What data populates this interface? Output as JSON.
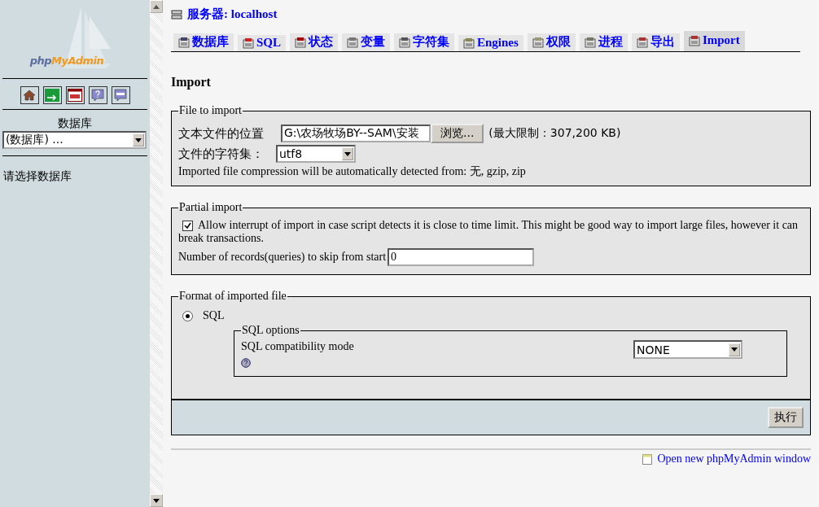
{
  "sidebar": {
    "logo": [
      "php",
      "MyAdmin"
    ],
    "icon_buttons": [
      {
        "kind": "home"
      },
      {
        "kind": "exit"
      },
      {
        "kind": "query"
      },
      {
        "kind": "help"
      },
      {
        "kind": "docs"
      }
    ],
    "db_label": "数据库",
    "db_select": {
      "value": "(数据库) ..."
    },
    "hint": "请选择数据库"
  },
  "server": {
    "label": "服务器",
    "host": ": localhost"
  },
  "tabs": [
    {
      "label": "数据库",
      "kind": "db",
      "selected": false
    },
    {
      "label": "SQL",
      "kind": "sql",
      "selected": false
    },
    {
      "label": "状态",
      "kind": "status",
      "selected": false
    },
    {
      "label": "变量",
      "kind": "vars",
      "selected": false
    },
    {
      "label": "字符集",
      "kind": "charset",
      "selected": false
    },
    {
      "label": "Engines",
      "kind": "engines",
      "selected": false
    },
    {
      "label": "权限",
      "kind": "priv",
      "selected": false
    },
    {
      "label": "进程",
      "kind": "proc",
      "selected": false
    },
    {
      "label": "导出",
      "kind": "export",
      "selected": false
    },
    {
      "label": "Import",
      "kind": "import",
      "selected": true
    }
  ],
  "heading": "Import",
  "file_to_import": {
    "legend": "File to import",
    "location_label": "文本文件的位置",
    "file_value": "G:\\农场牧场BY--SAM\\安装",
    "browse_button": "浏览...",
    "limit": "(最大限制：307,200 KB)",
    "charset_label": "文件的字符集：",
    "charset_value": "utf8",
    "compression_note": "Imported file compression will be automatically detected from: 无, gzip, zip"
  },
  "partial_import": {
    "legend": "Partial import",
    "allow_interrupt": {
      "label": "Allow interrupt of import in case script detects it is close to time limit. This might be good way to import large files, however it can break transactions.",
      "checked": true
    },
    "skip_label": "Number of records(queries) to skip from start",
    "skip_value": "0"
  },
  "format": {
    "legend": "Format of imported file",
    "options": [
      {
        "label": "SQL",
        "selected": true
      }
    ],
    "sql_options": {
      "legend": "SQL options",
      "compat_label": "SQL compatibility mode",
      "compat_value": "NONE"
    }
  },
  "go_button": "执行",
  "footer_link": "Open new phpMyAdmin window"
}
